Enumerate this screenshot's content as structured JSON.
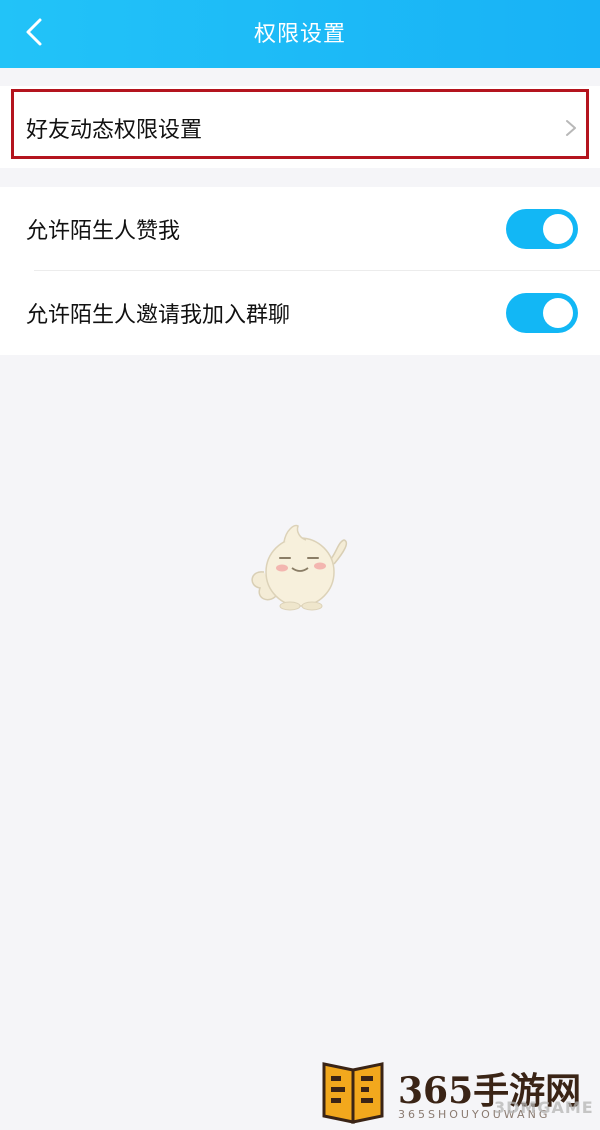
{
  "header": {
    "title": "权限设置",
    "back_icon": "chevron-left-icon",
    "background": "#1bb9f7"
  },
  "sections": {
    "moments_permission": {
      "label": "好友动态权限设置",
      "icon": "chevron-right-icon"
    },
    "allow_stranger_like": {
      "label": "允许陌生人赞我",
      "enabled": true
    },
    "allow_stranger_invite": {
      "label": "允许陌生人邀请我加入群聊",
      "enabled": true
    }
  },
  "colors": {
    "toggle_on": "#12b7f5",
    "highlight_border": "#b4141e",
    "page_background": "#f5f5f8"
  },
  "watermark": {
    "main": "365手游网",
    "sub": "365SHOUYOUWANG",
    "overlay": "3DMGAME"
  }
}
